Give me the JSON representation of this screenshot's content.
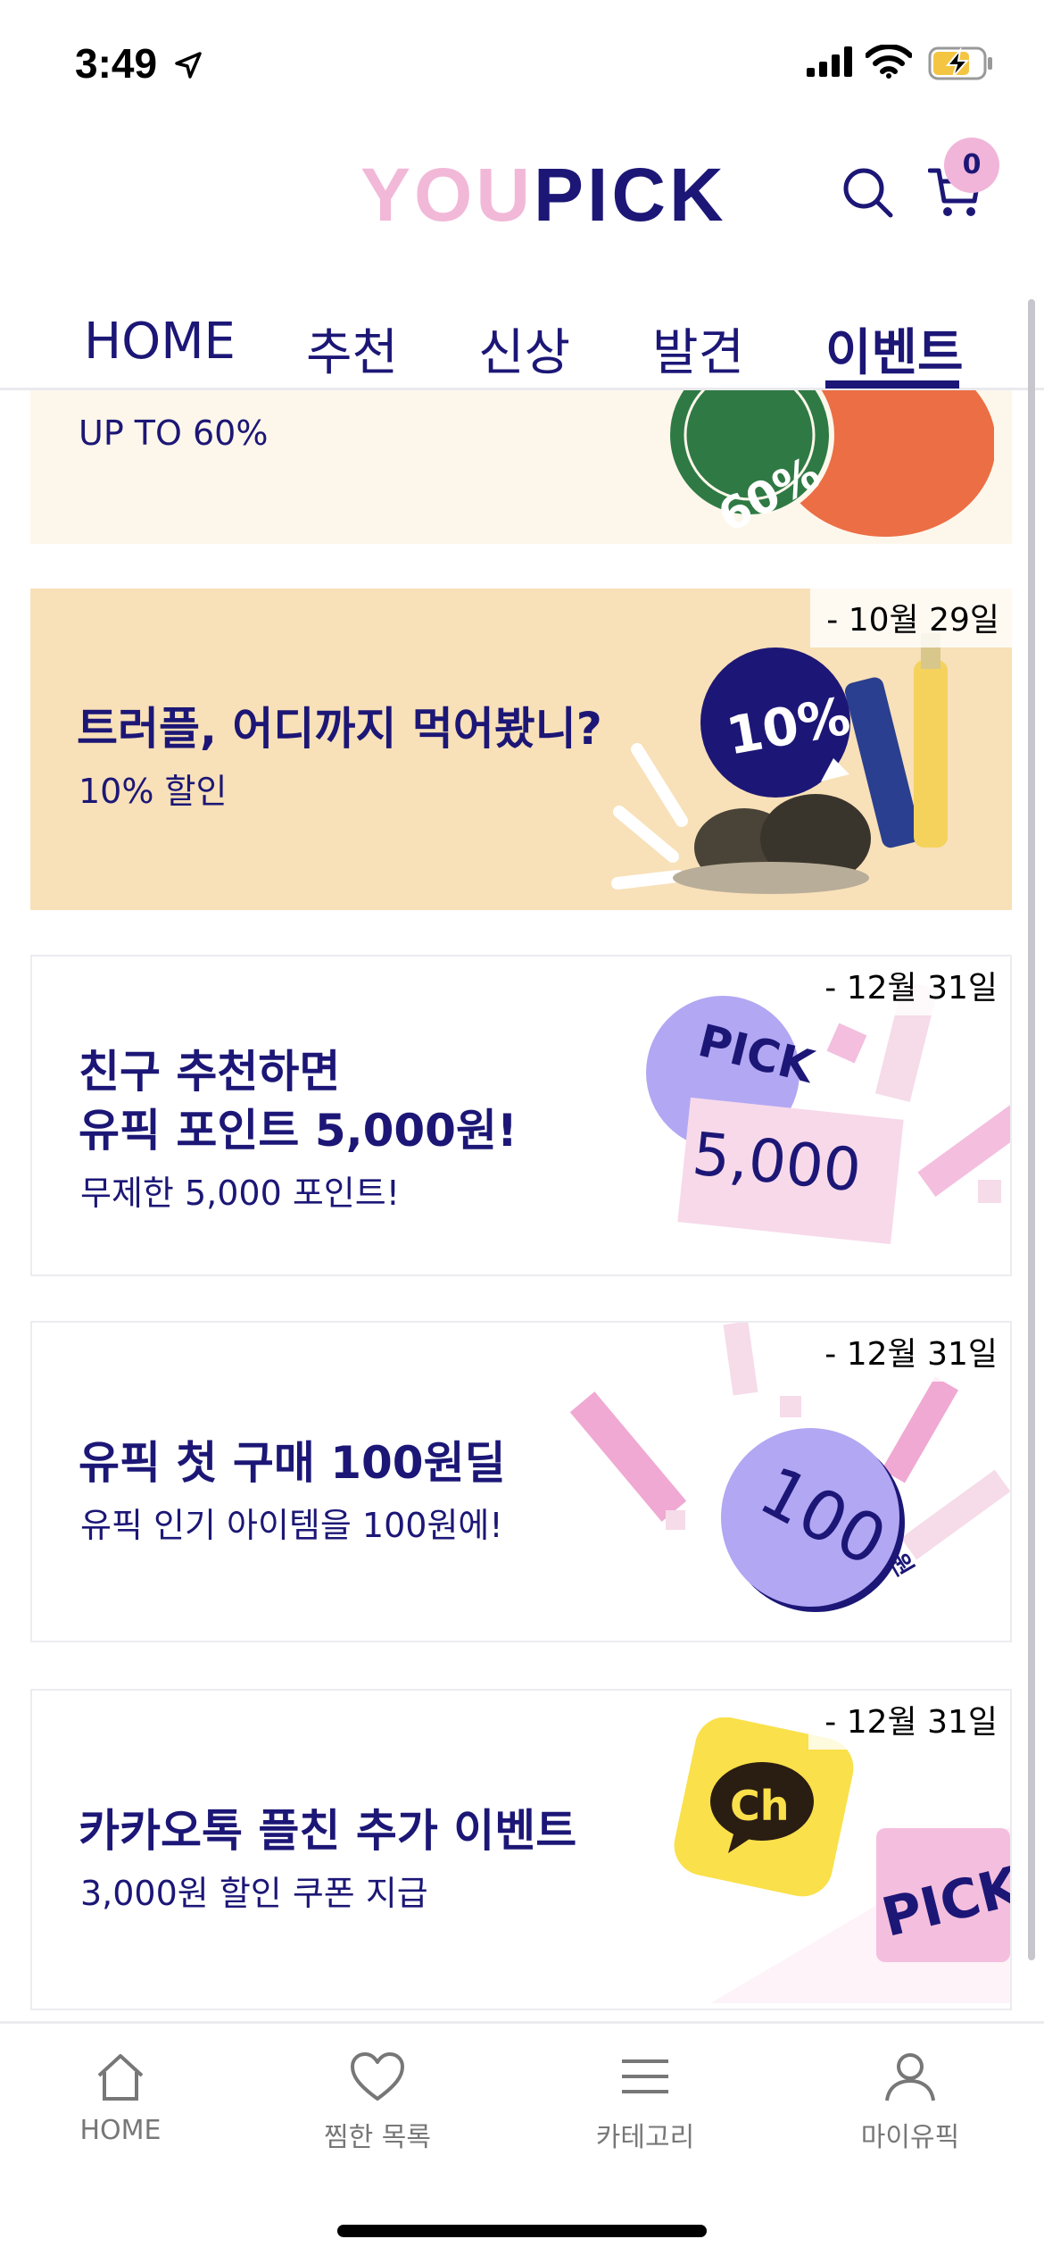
{
  "status_bar": {
    "time": "3:49"
  },
  "header": {
    "logo_you": "YOU",
    "logo_pick": "PICK",
    "cart_count": "0",
    "brand_color": "#1c1776",
    "accent_pink": "#f1b5d9"
  },
  "tabs": [
    {
      "label": "HOME"
    },
    {
      "label": "추천"
    },
    {
      "label": "신상"
    },
    {
      "label": "발견"
    },
    {
      "label": "이벤트",
      "active": true
    }
  ],
  "events": [
    {
      "title": "",
      "subtitle": "UP TO 60%",
      "date": "",
      "badge": "60%",
      "bg": "#fdf7eb"
    },
    {
      "title": "트러플, 어디까지 먹어봤니?",
      "subtitle": "10% 할인",
      "date": "- 10월 29일",
      "badge": "10%",
      "bg": "#f8e0b8"
    },
    {
      "title": "친구 추천하면\n유픽 포인트 5,000원!",
      "subtitle": "무제한 5,000 포인트!",
      "date": "- 12월 31일",
      "badge": "5,000",
      "badge2": "PICK",
      "bg": "#ffffff"
    },
    {
      "title": "유픽 첫 구매 100원딜",
      "subtitle": "유픽 인기 아이템을 100원에!",
      "date": "- 12월 31일",
      "badge": "100",
      "badge_unit": "원",
      "bg": "#ffffff"
    },
    {
      "title": "카카오톡 플친 추가 이벤트",
      "subtitle": "3,000원 할인 쿠폰 지급",
      "date": "- 12월 31일",
      "badge": "Ch",
      "badge2": "PICK",
      "bg": "#ffffff"
    }
  ],
  "bottom_nav": [
    {
      "label": "HOME",
      "icon": "home-icon"
    },
    {
      "label": "찜한 목록",
      "icon": "heart-icon"
    },
    {
      "label": "카테고리",
      "icon": "menu-icon"
    },
    {
      "label": "마이유픽",
      "icon": "user-icon"
    }
  ]
}
